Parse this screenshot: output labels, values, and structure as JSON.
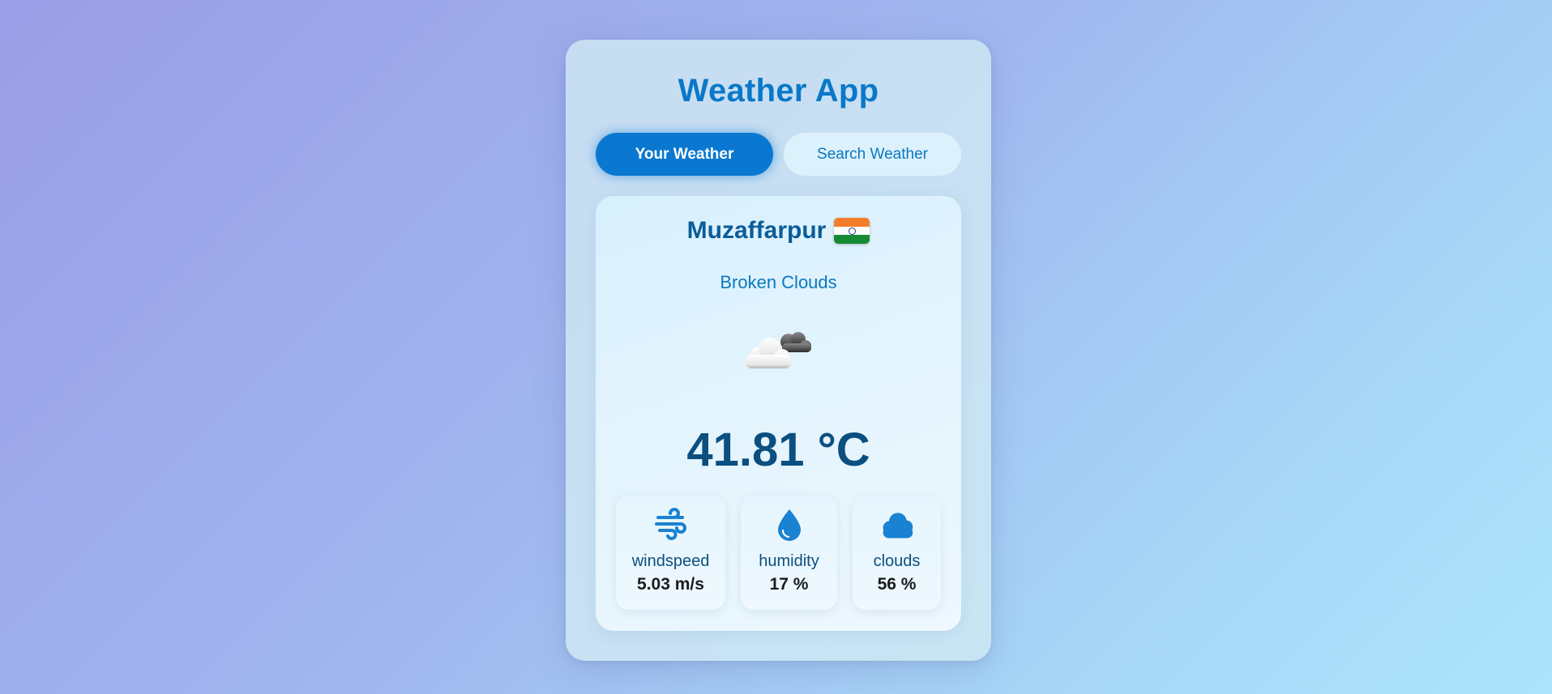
{
  "app": {
    "title": "Weather App"
  },
  "tabs": [
    {
      "label": "Your Weather",
      "active": true
    },
    {
      "label": "Search Weather",
      "active": false
    }
  ],
  "weather": {
    "city": "Muzaffarpur",
    "country_flag": "india-flag",
    "description": "Broken Clouds",
    "icon": "broken-clouds-icon",
    "temperature": "41.81 °C"
  },
  "stats": {
    "windspeed": {
      "label": "windspeed",
      "value": "5.03 m/s",
      "icon": "wind-icon"
    },
    "humidity": {
      "label": "humidity",
      "value": "17 %",
      "icon": "water-drop-icon"
    },
    "clouds": {
      "label": "clouds",
      "value": "56 %",
      "icon": "cloud-icon"
    }
  },
  "colors": {
    "accent": "#0a78d0",
    "title": "#0a78c8",
    "dark_text": "#0b4f80"
  }
}
